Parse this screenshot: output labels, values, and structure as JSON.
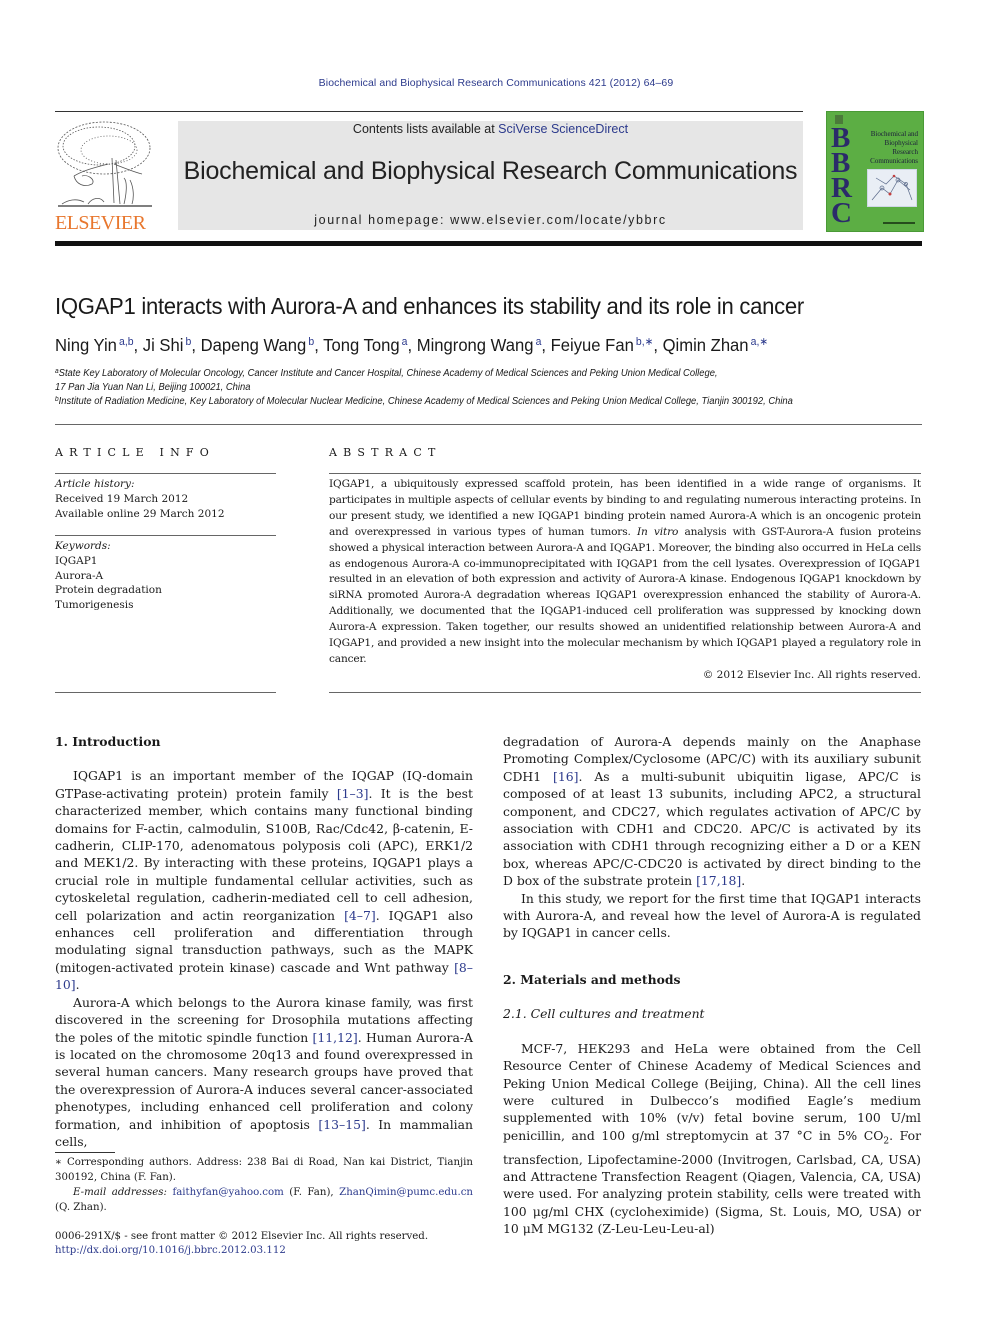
{
  "running_head": "Biochemical and Biophysical Research Communications 421 (2012) 64–69",
  "masthead": {
    "contents_prefix": "Contents lists available at ",
    "contents_link": "SciVerse ScienceDirect",
    "journal_name": "Biochemical and Biophysical Research Communications",
    "homepage": "journal homepage: www.elsevier.com/locate/ybbrc",
    "publisher_logo_text": "ELSEVIER",
    "cover": {
      "letters": "B\nB\nR\nC",
      "title": "Biochemical and Biophysical Research Communications",
      "color": "#5cae44"
    }
  },
  "article": {
    "title": "IQGAP1 interacts with Aurora-A and enhances its stability and its role in cancer",
    "authors": [
      {
        "name": "Ning Yin",
        "sup": "a,b",
        "sep": ", "
      },
      {
        "name": "Ji Shi",
        "sup": "b",
        "sep": ", "
      },
      {
        "name": "Dapeng Wang",
        "sup": "b",
        "sep": ", "
      },
      {
        "name": "Tong Tong",
        "sup": "a",
        "sep": ", "
      },
      {
        "name": "Mingrong Wang",
        "sup": "a",
        "sep": ", "
      },
      {
        "name": "Feiyue Fan",
        "sup": "b,∗",
        "sep": ", "
      },
      {
        "name": "Qimin Zhan",
        "sup": "a,∗",
        "sep": ""
      }
    ],
    "affiliations": [
      {
        "mark": "a",
        "line1": "State Key Laboratory of Molecular Oncology, Cancer Institute and Cancer Hospital, Chinese Academy of Medical Sciences and Peking Union Medical College,",
        "line2": "17 Pan Jia Yuan Nan Li, Beijing 100021, China"
      },
      {
        "mark": "b",
        "line1": "Institute of Radiation Medicine, Key Laboratory of Molecular Nuclear Medicine, Chinese Academy of Medical Sciences and Peking Union Medical College, Tianjin 300192, China"
      }
    ]
  },
  "article_info": {
    "heading": "ARTICLE INFO",
    "history_label": "Article history:",
    "received": "Received 19 March 2012",
    "available": "Available online 29 March 2012",
    "keywords_label": "Keywords:",
    "keywords": [
      "IQGAP1",
      "Aurora-A",
      "Protein degradation",
      "Tumorigenesis"
    ]
  },
  "abstract": {
    "heading": "ABSTRACT",
    "text_before_italic": "IQGAP1, a ubiquitously expressed scaffold protein, has been identified in a wide range of organisms. It participates in multiple aspects of cellular events by binding to and regulating numerous interacting proteins. In our present study, we identified a new IQGAP1 binding protein named Aurora-A which is an oncogenic protein and overexpressed in various types of human tumors. ",
    "italic": "In vitro",
    "text_after_italic": " analysis with GST-Aurora-A fusion proteins showed a physical interaction between Aurora-A and IQGAP1. Moreover, the binding also occurred in HeLa cells as endogenous Aurora-A co-immunoprecipitated with IQGAP1 from the cell lysates. Overexpression of IQGAP1 resulted in an elevation of both expression and activity of Aurora-A kinase. Endogenous IQGAP1 knockdown by siRNA promoted Aurora-A degradation whereas IQGAP1 overexpression enhanced the stability of Aurora-A. Additionally, we documented that the IQGAP1-induced cell proliferation was suppressed by knocking down Aurora-A expression. Taken together, our results showed an unidentified relationship between Aurora-A and IQGAP1, and provided a new insight into the molecular mechanism by which IQGAP1 played a regulatory role in cancer.",
    "copyright": "© 2012 Elsevier Inc. All rights reserved."
  },
  "body": {
    "intro_heading": "1. Introduction",
    "intro_p1": [
      {
        "t": "IQGAP1 is an important member of the IQGAP (IQ-domain GTPase-activating protein) protein family "
      },
      {
        "ref": "[1–3]"
      },
      {
        "t": ". It is the best characterized member, which contains many functional binding domains for F-actin, calmodulin, S100B, Rac/Cdc42, β-catenin, E-cadherin, CLIP-170, adenomatous polyposis coli (APC), ERK1/2 and MEK1/2. By interacting with these proteins, IQGAP1 plays a crucial role in multiple fundamental cellular activities, such as cytoskeletal regulation, cadherin-mediated cell to cell adhesion, cell polarization and actin reorganization "
      },
      {
        "ref": "[4–7]"
      },
      {
        "t": ". IQGAP1 also enhances cell proliferation and differentiation through modulating signal transduction pathways, such as the MAPK (mitogen-activated protein kinase) cascade and Wnt pathway "
      },
      {
        "ref": "[8–10]"
      },
      {
        "t": "."
      }
    ],
    "intro_p2": [
      {
        "t": "Aurora-A which belongs to the Aurora kinase family, was first discovered in the screening for Drosophila mutations affecting the poles of the mitotic spindle function "
      },
      {
        "ref": "[11,12]"
      },
      {
        "t": ". Human Aurora-A is located on the chromosome 20q13 and found overexpressed in several human cancers. Many research groups have proved that the overexpression of Aurora-A induces several cancer-associated phenotypes, including enhanced cell proliferation and colony formation, and inhibition of apoptosis "
      },
      {
        "ref": "[13–15]"
      },
      {
        "t": ". In mammalian cells,"
      }
    ],
    "right_p1": [
      {
        "t": "degradation of Aurora-A depends mainly on the Anaphase Promoting Complex/Cyclosome (APC/C) with its auxiliary subunit CDH1 "
      },
      {
        "ref": "[16]"
      },
      {
        "t": ". As a multi-subunit ubiquitin ligase, APC/C is composed of at least 13 subunits, including APC2, a structural component, and CDC27, which regulates activation of APC/C by association with CDH1 and CDC20. APC/C is activated by its association with CDH1 through recognizing either a D or a KEN box, whereas APC/C-CDC20 is activated by direct binding to the D box of the substrate protein "
      },
      {
        "ref": "[17,18]"
      },
      {
        "t": "."
      }
    ],
    "right_p2": "In this study, we report for the first time that IQGAP1 interacts with Aurora-A, and reveal how the level of Aurora-A is regulated by IQGAP1 in cancer cells.",
    "methods_heading": "2. Materials and methods",
    "methods_sub": "2.1. Cell cultures and treatment",
    "methods_p1_a": "MCF-7, HEK293 and HeLa were obtained from the Cell Resource Center of Chinese Academy of Medical Sciences and Peking Union Medical College (Beijing, China). All the cell lines were cultured in Dulbecco’s modified Eagle’s medium supplemented with 10% (v/v) fetal bovine serum, 100 U/ml penicillin, and 100 g/ml streptomycin at 37 °C in 5% CO",
    "methods_p1_sub": "2",
    "methods_p1_b": ". For transfection, Lipofectamine-2000 (Invitrogen, Carlsbad, CA, USA) and Attractene Transfection Reagent (Qiagen, Valencia, CA, USA) were used. For analyzing protein stability, cells were treated with 100 μg/ml CHX (cycloheximide) (Sigma, St. Louis, MO, USA) or 10 μM MG132 (Z-Leu-Leu-Leu-al)"
  },
  "footnotes": {
    "corresponding": "∗ Corresponding authors. Address: 238 Bai di Road, Nan kai District, Tianjin 300192, China (F. Fan).",
    "email_label": "E-mail addresses:",
    "email1": "faithyfan@yahoo.com",
    "email1_who": " (F. Fan), ",
    "email2": "ZhanQimin@pumc.edu.cn",
    "email2_who": " (Q. Zhan).",
    "front_matter": "0006-291X/$ - see front matter © 2012 Elsevier Inc. All rights reserved.",
    "doi": "http://dx.doi.org/10.1016/j.bbrc.2012.03.112"
  },
  "colors": {
    "link": "#2c3a8c",
    "elsevier_orange": "#e8772e",
    "masthead_gray": "#e6e6e6",
    "cover_green": "#5cae44"
  }
}
